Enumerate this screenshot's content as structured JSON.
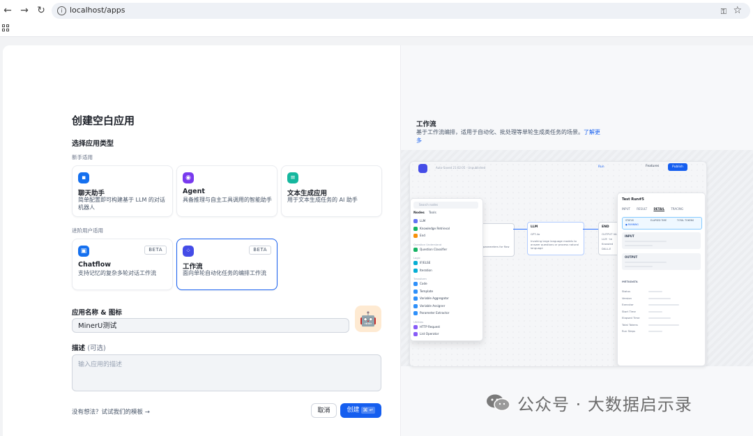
{
  "browser": {
    "url": "localhost/apps"
  },
  "modal": {
    "title": "创建空白应用",
    "app_type_label": "选择应用类型",
    "beginner_label": "新手适用",
    "advanced_label": "进阶用户适用",
    "cards": [
      {
        "name": "聊天助手",
        "desc": "简单配置即可构建基于 LLM 的对话机器人",
        "color": "#1570ef",
        "icon": "chat-bubble-icon"
      },
      {
        "name": "Agent",
        "desc": "具备推理与自主工具调用的智能助手",
        "color": "#7839ee",
        "icon": "robot-icon"
      },
      {
        "name": "文本生成应用",
        "desc": "用于文本生成任务的 AI 助手",
        "color": "#15b79e",
        "icon": "text-generate-icon"
      },
      {
        "name": "Chatflow",
        "desc": "支持记忆的复杂多轮对话工作流",
        "badge": "BETA",
        "color": "#1570ef",
        "icon": "chatflow-icon"
      },
      {
        "name": "工作流",
        "desc": "面向单轮自动化任务的编排工作流",
        "badge": "BETA",
        "color": "#444ce7",
        "icon": "workflow-icon",
        "selected": true
      }
    ],
    "name_label": "应用名称 & 图标",
    "name_value": "MinerU测试",
    "desc_label": "描述",
    "desc_optional": "(可选)",
    "desc_placeholder": "输入应用的描述",
    "template_link": "没有想法？试试我们的模板 →",
    "cancel": "取消",
    "create": "创建",
    "create_shortcut": "⌘ ↵",
    "avatar_emoji": "🤖"
  },
  "preview": {
    "title": "工作流",
    "desc": "基于工作流编排，适用于自动化、批处理等单轮生成类任务的场景。",
    "link": "了解更多",
    "screenshot": {
      "header": "Auto-Saved 21:02:05 · Unpublished",
      "run": "Run",
      "features": "Features",
      "publish": "Publish",
      "search_placeholder": "Search nodes",
      "tabs": [
        "Nodes",
        "Tools"
      ],
      "palette": [
        {
          "type": "item",
          "label": "LLM",
          "color": "#6172f3"
        },
        {
          "type": "item",
          "label": "Knowledge Retrieval",
          "color": "#16b364"
        },
        {
          "type": "item",
          "label": "End",
          "color": "#f79009"
        },
        {
          "type": "group",
          "label": "Question Understand"
        },
        {
          "type": "item",
          "label": "Question Classifier",
          "color": "#16b364"
        },
        {
          "type": "group",
          "label": "Logic"
        },
        {
          "type": "item",
          "label": "IF/ELSE",
          "color": "#06aed4"
        },
        {
          "type": "item",
          "label": "Iteration",
          "color": "#06aed4"
        },
        {
          "type": "group",
          "label": "Transform"
        },
        {
          "type": "item",
          "label": "Code",
          "color": "#2e90fa"
        },
        {
          "type": "item",
          "label": "Template",
          "color": "#2e90fa"
        },
        {
          "type": "item",
          "label": "Variable Aggregator",
          "color": "#2e90fa"
        },
        {
          "type": "item",
          "label": "Variable Assigner",
          "color": "#2e90fa"
        },
        {
          "type": "item",
          "label": "Parameter Extractor",
          "color": "#2e90fa"
        },
        {
          "type": "group",
          "label": "Utilities"
        },
        {
          "type": "item",
          "label": "HTTP Request",
          "color": "#875bf7"
        },
        {
          "type": "item",
          "label": "List Operator",
          "color": "#875bf7"
        }
      ],
      "llm_node": {
        "title": "LLM",
        "model": "GPT-4o",
        "tag": "CHAT",
        "desc": "Invoking large language models to answer questions or process natural language"
      },
      "end_node": {
        "title": "END",
        "output_label": "OUTPUT VARS",
        "outputs": [
          "LLM · te",
          "Knowled",
          "DALL-E"
        ]
      },
      "left_node_desc": "parameters for flow",
      "test_run": {
        "title": "Test Run#5",
        "tabs": [
          "INPUT",
          "RESULT",
          "DETAIL",
          "TRACING"
        ],
        "active_tab": "DETAIL",
        "status_label": "STATUS",
        "status_value": "● RUNNING",
        "elapsed_label": "ELAPSED TIME",
        "tokens_label": "TOTAL TOKENS",
        "input_label": "INPUT",
        "output_label": "OUTPUT",
        "metadata_label": "METADATA",
        "metadata_rows": [
          "Status",
          "Version",
          "Executor",
          "Start Time",
          "Elapsed Time",
          "Total Tokens",
          "Run Steps"
        ]
      }
    }
  },
  "watermark": "公众号 · 大数据启示录"
}
